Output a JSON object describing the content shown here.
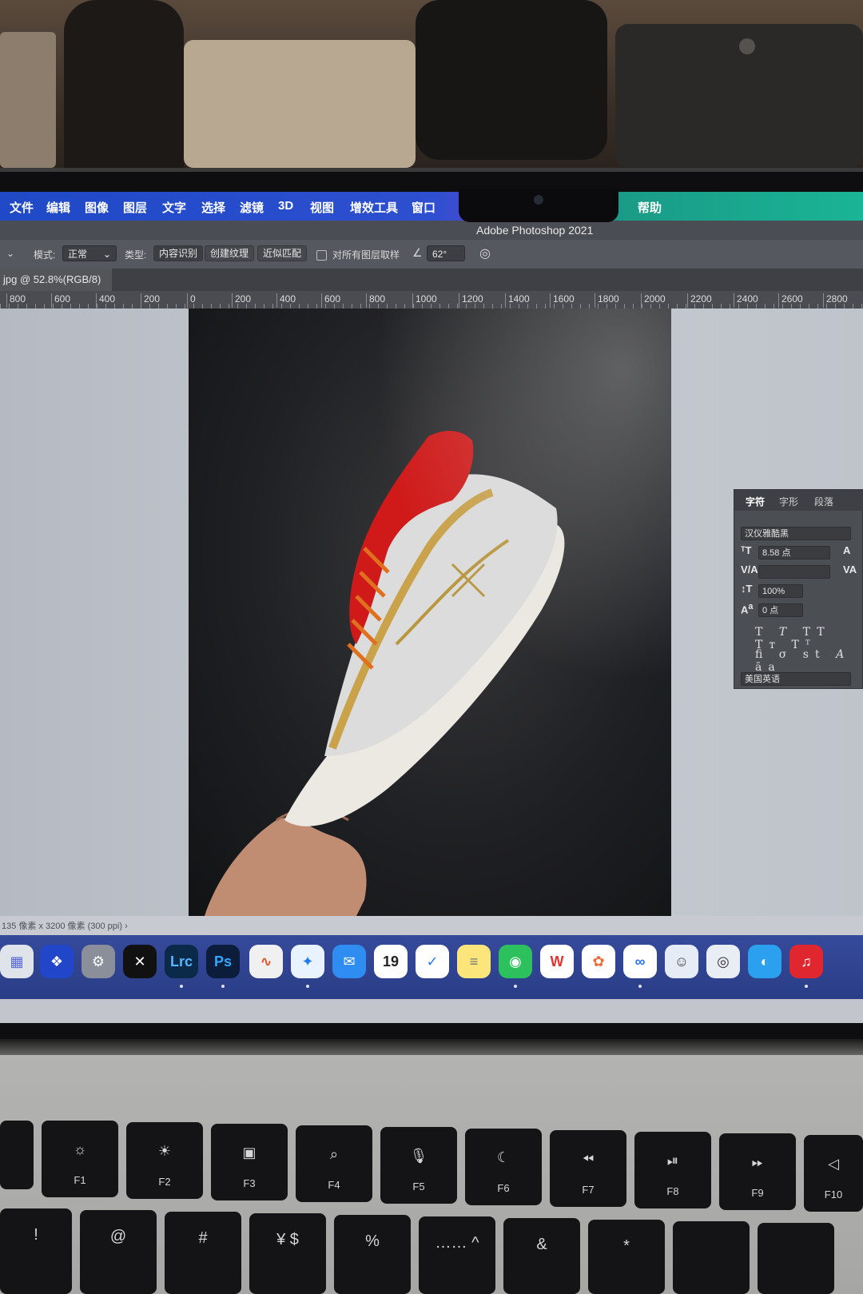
{
  "menubar": {
    "items": [
      "文件",
      "编辑",
      "图像",
      "图层",
      "文字",
      "选择",
      "滤镜",
      "3D",
      "视图",
      "增效工具",
      "窗口"
    ],
    "help": "帮助"
  },
  "app_title": "Adobe Photoshop 2021",
  "options": {
    "mode_label": "模式:",
    "mode_value": "正常",
    "type_label": "类型:",
    "btn_content_aware": "内容识别",
    "btn_create_texture": "创建纹理",
    "btn_proximity_match": "近似匹配",
    "sample_all_layers": "对所有图层取样",
    "angle_value": "62°"
  },
  "document_tab": "jpg @ 52.8%(RGB/8)",
  "ruler_ticks": [
    "800",
    "600",
    "400",
    "200",
    "0",
    "200",
    "400",
    "600",
    "800",
    "1000",
    "1200",
    "1400",
    "1600",
    "1800",
    "2000",
    "2200",
    "2400",
    "2600",
    "2800"
  ],
  "character_panel": {
    "tabs": [
      "字符",
      "字形",
      "段落"
    ],
    "font_family": "汉仪雅酷黑",
    "font_size": "8.58 点",
    "kerning": "",
    "scale": "100%",
    "baseline": "0 点",
    "language": "美国英语"
  },
  "status": "135 像素 x 3200 像素 (300 ppi) ›",
  "dock": {
    "apps": [
      "launchpad",
      "gamma",
      "system-preferences",
      "capcut",
      "Lrc",
      "Ps",
      "curve",
      "safari",
      "mail",
      "calendar",
      "reminders",
      "notes",
      "wechat",
      "wps",
      "photos",
      "baidu-netdisk",
      "avatar",
      "screenshot",
      "browser",
      "netease-music"
    ],
    "calendar_day": "19"
  },
  "keyboard": {
    "fkeys": [
      "F1",
      "F2",
      "F3",
      "F4",
      "F5",
      "F6",
      "F7",
      "F8",
      "F9",
      "F10"
    ],
    "number_row": [
      "!",
      "@",
      "#",
      "¥ $",
      "%",
      "…… ^",
      "&",
      "*"
    ]
  }
}
